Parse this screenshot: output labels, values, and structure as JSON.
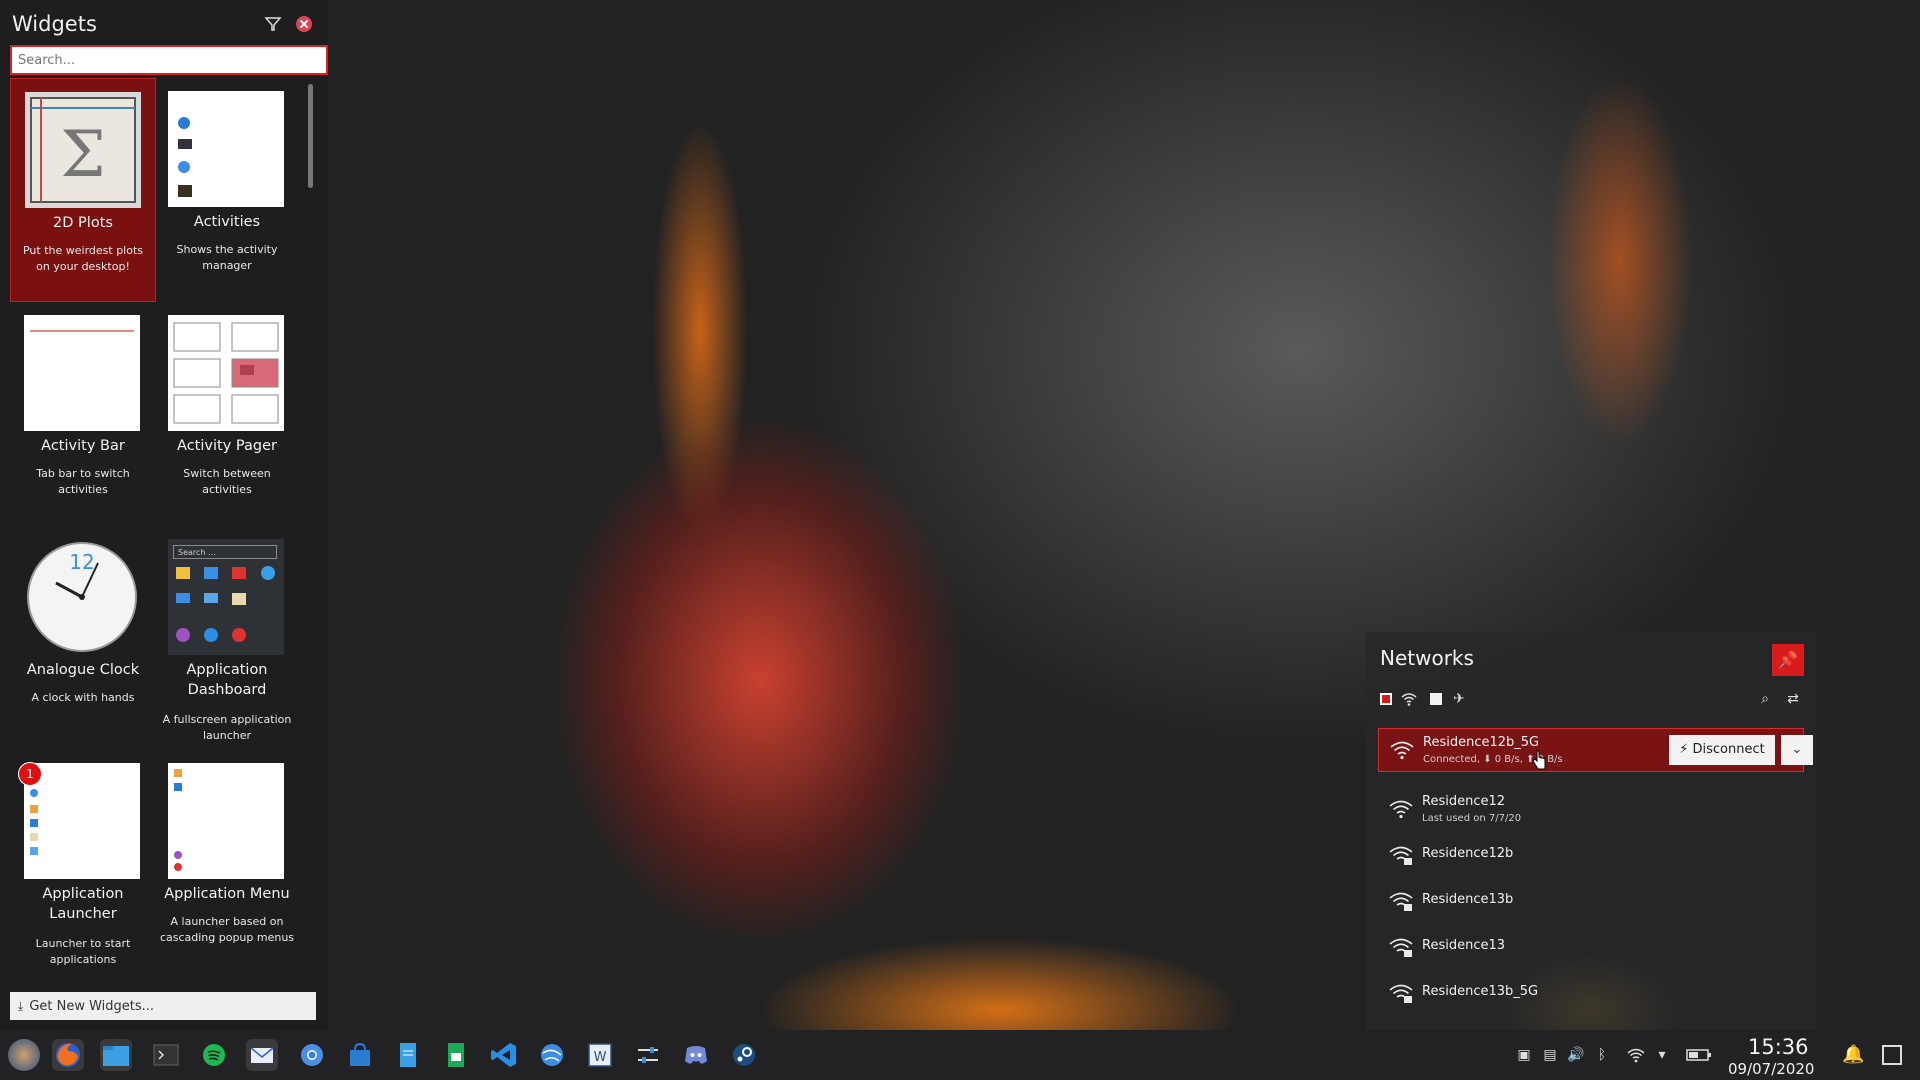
{
  "widgets_panel": {
    "title": "Widgets",
    "search_placeholder": "Search...",
    "get_new_label": "Get New Widgets...",
    "badge_count": "1",
    "widgets": [
      {
        "name": "2D Plots",
        "desc": "Put the weirdest plots on your desktop!"
      },
      {
        "name": "Activities",
        "desc": "Shows the activity manager"
      },
      {
        "name": "Activity Bar",
        "desc": "Tab bar to switch activities"
      },
      {
        "name": "Activity Pager",
        "desc": "Switch between activities"
      },
      {
        "name": "Analogue Clock",
        "desc": "A clock with hands"
      },
      {
        "name": "Application Dashboard",
        "desc": "A fullscreen application launcher"
      },
      {
        "name": "Application Launcher",
        "desc": "Launcher to start applications"
      },
      {
        "name": "Application Menu",
        "desc": "A launcher based on cascading popup menus"
      }
    ],
    "dashboard_search": "Search ..."
  },
  "networks": {
    "title": "Networks",
    "disconnect_label": "Disconnect",
    "items": [
      {
        "name": "Residence12b_5G",
        "sub": "Connected, ⬇ 0 B/s, ⬆ 0 B/s"
      },
      {
        "name": "Residence12",
        "sub": "Last used on 7/7/20"
      },
      {
        "name": "Residence12b",
        "sub": ""
      },
      {
        "name": "Residence13b",
        "sub": ""
      },
      {
        "name": "Residence13",
        "sub": ""
      },
      {
        "name": "Residence13b_5G",
        "sub": ""
      }
    ]
  },
  "taskbar": {
    "time": "15:36",
    "date": "09/07/2020",
    "apps": [
      "app-launcher",
      "firefox",
      "dolphin",
      "konsole",
      "spotify",
      "thunderbird",
      "chromium",
      "discover",
      "kate",
      "libreoffice-calc",
      "vscode",
      "browser",
      "wps-writer",
      "settings",
      "discord",
      "steam"
    ]
  },
  "colors": {
    "accent": "#d81c1c",
    "selected_bg": "#7a1414",
    "panel_bg": "#1e1e20",
    "taskbar_bg": "#222224"
  }
}
